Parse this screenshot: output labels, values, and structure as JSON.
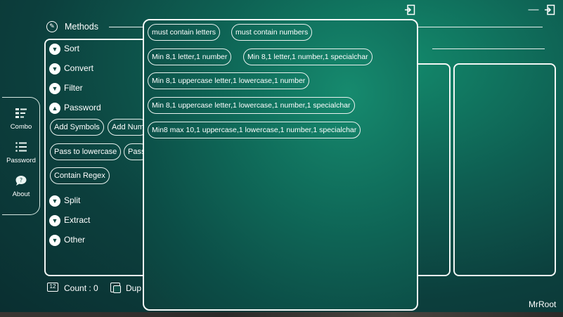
{
  "sidebar": {
    "items": [
      {
        "label": "Combo",
        "icon": "list-grid-icon"
      },
      {
        "label": "Password",
        "icon": "numbered-list-icon"
      },
      {
        "label": "About",
        "icon": "chat-bubble-icon"
      }
    ]
  },
  "methods": {
    "title": "Methods",
    "categories": [
      "Sort",
      "Convert",
      "Filter",
      "Password",
      "Split",
      "Extract",
      "Other"
    ],
    "password_actions": [
      "Add Symbols",
      "Add Num",
      "Pass to lowercase",
      "Pass",
      "Contain Regex"
    ]
  },
  "footer": {
    "count_label": "Count : 0",
    "dup_label": "Dup"
  },
  "popup": {
    "options": [
      "must contain letters",
      "must contain numbers",
      "Min 8,1 letter,1 number",
      "Min 8,1 letter,1 number,1 specialchar",
      "Min 8,1 uppercase letter,1 lowercase,1 number",
      "Min 8,1 uppercase letter,1 lowercase,1 number,1 specialchar",
      "Min8 max 10,1 uppercase,1 lowercase,1 number,1 specialchar"
    ]
  },
  "author": "MrRoot",
  "colors": {
    "accent": "#138a6c",
    "background": "#0c3f3d",
    "border": "#f2f7f5"
  }
}
